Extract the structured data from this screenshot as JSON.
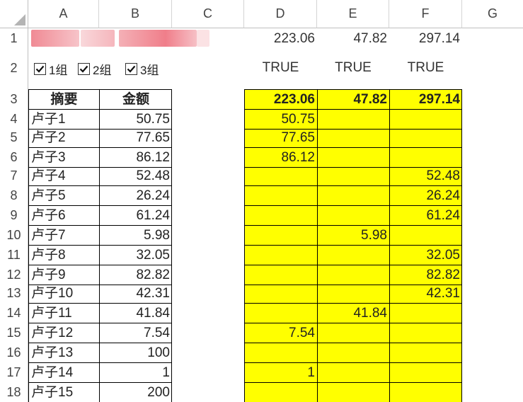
{
  "columns": [
    "A",
    "B",
    "C",
    "D",
    "E",
    "F",
    "G"
  ],
  "rows": [
    "1",
    "2",
    "3",
    "4",
    "5",
    "6",
    "7",
    "8",
    "9",
    "10",
    "11",
    "12",
    "13",
    "14",
    "15",
    "16",
    "17",
    "18"
  ],
  "row1": {
    "d": "223.06",
    "e": "47.82",
    "f": "297.14"
  },
  "checkboxes": [
    {
      "label": "1组",
      "checked": true
    },
    {
      "label": "2组",
      "checked": true
    },
    {
      "label": "3组",
      "checked": true
    }
  ],
  "row2": {
    "d": "TRUE",
    "e": "TRUE",
    "f": "TRUE"
  },
  "headers": {
    "a": "摘要",
    "b": "金额"
  },
  "totals": {
    "d": "223.06",
    "e": "47.82",
    "f": "297.14"
  },
  "data_rows": [
    {
      "a": "卢子1",
      "b": "50.75",
      "d": "50.75",
      "e": "",
      "f": ""
    },
    {
      "a": "卢子2",
      "b": "77.65",
      "d": "77.65",
      "e": "",
      "f": ""
    },
    {
      "a": "卢子3",
      "b": "86.12",
      "d": "86.12",
      "e": "",
      "f": ""
    },
    {
      "a": "卢子4",
      "b": "52.48",
      "d": "",
      "e": "",
      "f": "52.48"
    },
    {
      "a": "卢子5",
      "b": "26.24",
      "d": "",
      "e": "",
      "f": "26.24"
    },
    {
      "a": "卢子6",
      "b": "61.24",
      "d": "",
      "e": "",
      "f": "61.24"
    },
    {
      "a": "卢子7",
      "b": "5.98",
      "d": "",
      "e": "5.98",
      "f": ""
    },
    {
      "a": "卢子8",
      "b": "32.05",
      "d": "",
      "e": "",
      "f": "32.05"
    },
    {
      "a": "卢子9",
      "b": "82.82",
      "d": "",
      "e": "",
      "f": "82.82"
    },
    {
      "a": "卢子10",
      "b": "42.31",
      "d": "",
      "e": "",
      "f": "42.31"
    },
    {
      "a": "卢子11",
      "b": "41.84",
      "d": "",
      "e": "41.84",
      "f": ""
    },
    {
      "a": "卢子12",
      "b": "7.54",
      "d": "7.54",
      "e": "",
      "f": ""
    },
    {
      "a": "卢子13",
      "b": "100",
      "d": "",
      "e": "",
      "f": ""
    },
    {
      "a": "卢子14",
      "b": "1",
      "d": "1",
      "e": "",
      "f": ""
    },
    {
      "a": "卢子15",
      "b": "200",
      "d": "",
      "e": "",
      "f": ""
    }
  ],
  "colors": {
    "highlight": "#ffff00",
    "redacted": "#f0a0a8"
  }
}
